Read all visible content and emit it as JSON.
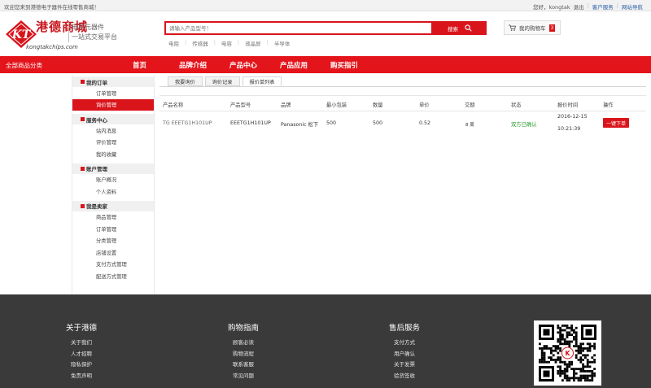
{
  "topbar": {
    "welcome": "欢迎您来到港德电子器件在线零售商城！",
    "greeting": "您好，kongtak",
    "logout": "退出",
    "customer_service": "客户服务",
    "site_nav": "网站导航"
  },
  "brand": {
    "name": "港德商城",
    "domain": "kongtakchips.com",
    "slogan_line1": "电子元器件",
    "slogan_line2": "一站式交易平台",
    "logo_letters": "KT",
    "color": "#d9141b"
  },
  "search": {
    "placeholder": "请输入产品型号！",
    "button_label": "搜索",
    "hotwords": [
      "电阻",
      "传感器",
      "电容",
      "液晶屏",
      "半导体"
    ]
  },
  "cart": {
    "label": "我的购物车",
    "count": "3"
  },
  "nav": {
    "all_categories": "全部商品分类",
    "items": [
      "首页",
      "品牌介绍",
      "产品中心",
      "产品应用",
      "购买指引"
    ]
  },
  "sidebar": {
    "groups": [
      {
        "title": "我的订单",
        "items": [
          "订单管理",
          "询价管理"
        ]
      },
      {
        "title": "服务中心",
        "items": [
          "站内消息",
          "评价管理",
          "我的收藏"
        ]
      },
      {
        "title": "账户管理",
        "items": [
          "账户概况",
          "个人资料"
        ]
      },
      {
        "title": "我是卖家",
        "items": [
          "商品管理",
          "订单管理",
          "分类管理",
          "店铺设置",
          "支付方式管理",
          "配送方式管理"
        ]
      }
    ],
    "active_item": "询价管理"
  },
  "tabs": [
    "我要询价",
    "询价记录",
    "报价单列表"
  ],
  "active_tab": "报价单列表",
  "table": {
    "headers": [
      "产品名称",
      "产品型号",
      "品牌",
      "最小包装",
      "数量",
      "单价",
      "交期",
      "状态",
      "报价时间",
      "操作"
    ],
    "rows": [
      {
        "product_name": "TG EEETG1H101UP",
        "model": "EEETG1H101UP",
        "brand": "Panasonic 松下",
        "min_pack": "500",
        "quantity": "500",
        "unit_price": "0.52",
        "lead_time": "8 周",
        "status": "双方已确认",
        "quote_date": "2016-12-15",
        "quote_time": "10:21:39",
        "action": "一键下单"
      }
    ]
  },
  "footer": {
    "columns": [
      {
        "title": "关于港德",
        "links": [
          "关于我们",
          "人才招聘",
          "隐私保护",
          "免责声明"
        ]
      },
      {
        "title": "购物指南",
        "links": [
          "顾客必读",
          "购物流程",
          "联系客服",
          "常见问题"
        ]
      },
      {
        "title": "售后服务",
        "links": [
          "支付方式",
          "用户确认",
          "关于发票",
          "验货签收"
        ]
      }
    ]
  }
}
